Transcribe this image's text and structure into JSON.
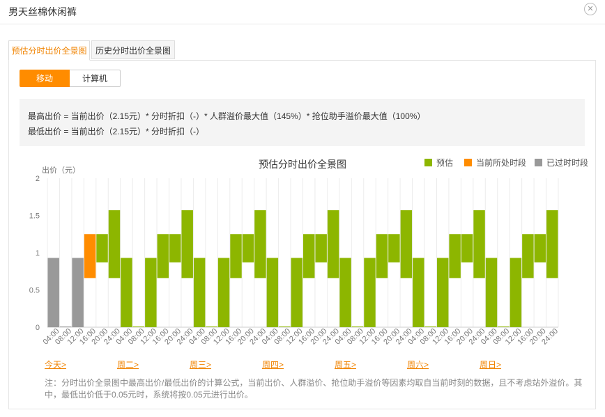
{
  "dialog": {
    "title": "男天丝棉休闲裤",
    "close_glyph": "✕"
  },
  "tabs": [
    {
      "label": "预估分时出价全景图",
      "active": true
    },
    {
      "label": "历史分时出价全景图",
      "active": false
    }
  ],
  "device_toggle": {
    "mobile": "移动",
    "computer": "计算机",
    "selected": "移动"
  },
  "formula": {
    "max_line": "最高出价 = 当前出价（2.15元）* 分时折扣（-）* 人群溢价最大值（145%）* 抢位助手溢价最大值（100%）",
    "min_line": "最低出价 = 当前出价（2.15元）* 分时折扣（-）"
  },
  "colors": {
    "accent": "#ff8c00",
    "forecast": "#8db600",
    "current": "#ff8c00",
    "past": "#999999"
  },
  "day_links": [
    "今天>",
    "周二>",
    "周三>",
    "周四>",
    "周五>",
    "周六>",
    "周日>"
  ],
  "note": "注：分时出价全景图中最高出价/最低出价的计算公式，当前出价、人群溢价、抢位助手溢价等因素均取自当前时刻的数据，且不考虑站外溢价。其中，最低出价低于0.05元时，系统将按0.05元进行出价。",
  "chart_data": {
    "type": "bar",
    "title": "预估分时出价全景图",
    "ylabel": "出价（元）",
    "ylim": [
      0,
      2
    ],
    "yticks": [
      "0",
      "0.5",
      "1",
      "1.5",
      "2"
    ],
    "grid": "vertical",
    "legend_position": "top-right",
    "legend": [
      {
        "label": "预估",
        "color": "#8db600"
      },
      {
        "label": "当前所处时段",
        "color": "#ff8c00"
      },
      {
        "label": "已过时时段",
        "color": "#999999"
      }
    ],
    "x_tick_labels": [
      "04:00",
      "08:00",
      "12:00",
      "16:00",
      "20:00",
      "24:00",
      "04:00",
      "08:00",
      "12:00",
      "16:00",
      "20:00",
      "24:00",
      "04:00",
      "08:00",
      "12:00",
      "16:00",
      "20:00",
      "24:00",
      "04:00",
      "08:00",
      "12:00",
      "16:00",
      "20:00",
      "24:00",
      "04:00",
      "08:00",
      "12:00",
      "16:00",
      "20:00",
      "24:00",
      "04:00",
      "08:00",
      "12:00",
      "16:00",
      "20:00",
      "24:00",
      "04:00",
      "08:00",
      "12:00",
      "16:00",
      "20:00",
      "24:00"
    ],
    "slots": [
      {
        "low": 0,
        "high": 0.93,
        "status": "past"
      },
      {
        "low": 0,
        "high": 0,
        "status": "past"
      },
      {
        "low": 0,
        "high": 0.93,
        "status": "past"
      },
      {
        "low": 0.66,
        "high": 1.25,
        "status": "current"
      },
      {
        "low": 0.87,
        "high": 1.25,
        "status": "forecast"
      },
      {
        "low": 0.66,
        "high": 1.57,
        "status": "forecast"
      },
      {
        "low": 0,
        "high": 0.93,
        "status": "forecast"
      },
      {
        "low": 0,
        "high": 0,
        "status": "forecast"
      },
      {
        "low": 0,
        "high": 0.93,
        "status": "forecast"
      },
      {
        "low": 0.66,
        "high": 1.25,
        "status": "forecast"
      },
      {
        "low": 0.87,
        "high": 1.25,
        "status": "forecast"
      },
      {
        "low": 0.66,
        "high": 1.57,
        "status": "forecast"
      },
      {
        "low": 0,
        "high": 0.93,
        "status": "forecast"
      },
      {
        "low": 0,
        "high": 0,
        "status": "forecast"
      },
      {
        "low": 0,
        "high": 0.93,
        "status": "forecast"
      },
      {
        "low": 0.66,
        "high": 1.25,
        "status": "forecast"
      },
      {
        "low": 0.87,
        "high": 1.25,
        "status": "forecast"
      },
      {
        "low": 0.66,
        "high": 1.57,
        "status": "forecast"
      },
      {
        "low": 0,
        "high": 0.93,
        "status": "forecast"
      },
      {
        "low": 0,
        "high": 0,
        "status": "forecast"
      },
      {
        "low": 0,
        "high": 0.93,
        "status": "forecast"
      },
      {
        "low": 0.66,
        "high": 1.25,
        "status": "forecast"
      },
      {
        "low": 0.87,
        "high": 1.25,
        "status": "forecast"
      },
      {
        "low": 0.66,
        "high": 1.57,
        "status": "forecast"
      },
      {
        "low": 0,
        "high": 0.93,
        "status": "forecast"
      },
      {
        "low": 0,
        "high": 0,
        "status": "forecast"
      },
      {
        "low": 0,
        "high": 0.93,
        "status": "forecast"
      },
      {
        "low": 0.66,
        "high": 1.25,
        "status": "forecast"
      },
      {
        "low": 0.87,
        "high": 1.25,
        "status": "forecast"
      },
      {
        "low": 0.66,
        "high": 1.57,
        "status": "forecast"
      },
      {
        "low": 0,
        "high": 0.93,
        "status": "forecast"
      },
      {
        "low": 0,
        "high": 0,
        "status": "forecast"
      },
      {
        "low": 0,
        "high": 0.93,
        "status": "forecast"
      },
      {
        "low": 0.66,
        "high": 1.25,
        "status": "forecast"
      },
      {
        "low": 0.87,
        "high": 1.25,
        "status": "forecast"
      },
      {
        "low": 0.66,
        "high": 1.57,
        "status": "forecast"
      },
      {
        "low": 0,
        "high": 0.93,
        "status": "forecast"
      },
      {
        "low": 0,
        "high": 0,
        "status": "forecast"
      },
      {
        "low": 0,
        "high": 0.93,
        "status": "forecast"
      },
      {
        "low": 0.66,
        "high": 1.25,
        "status": "forecast"
      },
      {
        "low": 0.87,
        "high": 1.25,
        "status": "forecast"
      },
      {
        "low": 0.66,
        "high": 1.57,
        "status": "forecast"
      }
    ]
  }
}
